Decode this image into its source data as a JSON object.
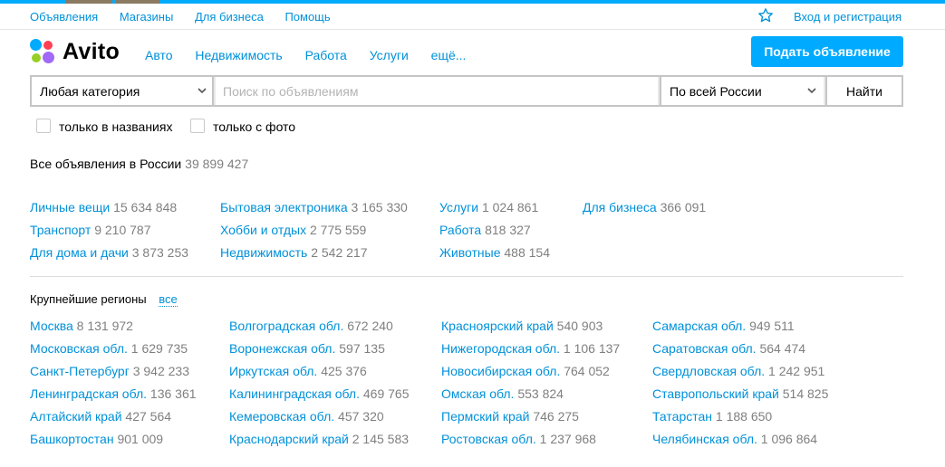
{
  "topbar": {
    "links": [
      "Объявления",
      "Магазины",
      "Для бизнеса",
      "Помощь"
    ],
    "login": "Вход и регистрация"
  },
  "header": {
    "logo": "Avito",
    "nav": [
      "Авто",
      "Недвижимость",
      "Работа",
      "Услуги",
      "ещё..."
    ],
    "post_button": "Подать объявление"
  },
  "search": {
    "category": "Любая категория",
    "placeholder": "Поиск по объявлениям",
    "value": "",
    "region": "По всей России",
    "button": "Найти"
  },
  "options": {
    "titles_only": "только в названиях",
    "with_photo": "только с фото",
    "titles_only_checked": false,
    "with_photo_checked": false
  },
  "total": {
    "label": "Все объявления в России",
    "count": "39 899 427"
  },
  "categories": [
    {
      "name": "Личные вещи",
      "count": "15 634 848"
    },
    {
      "name": "Транспорт",
      "count": "9 210 787"
    },
    {
      "name": "Для дома и дачи",
      "count": "3 873 253"
    },
    {
      "name": "Бытовая электроника",
      "count": "3 165 330"
    },
    {
      "name": "Хобби и отдых",
      "count": "2 775 559"
    },
    {
      "name": "Недвижимость",
      "count": "2 542 217"
    },
    {
      "name": "Услуги",
      "count": "1 024 861"
    },
    {
      "name": "Работа",
      "count": "818 327"
    },
    {
      "name": "Животные",
      "count": "488 154"
    },
    {
      "name": "Для бизнеса",
      "count": "366 091"
    }
  ],
  "regions_section": {
    "title": "Крупнейшие регионы",
    "all_link": "все"
  },
  "regions": [
    {
      "name": "Москва",
      "count": "8 131 972"
    },
    {
      "name": "Московская обл.",
      "count": "1 629 735"
    },
    {
      "name": "Санкт-Петербург",
      "count": "3 942 233"
    },
    {
      "name": "Ленинградская обл.",
      "count": "136 361"
    },
    {
      "name": "Алтайский край",
      "count": "427 564"
    },
    {
      "name": "Башкортостан",
      "count": "901 009"
    },
    {
      "name": "Волгоградская обл.",
      "count": "672 240"
    },
    {
      "name": "Воронежская обл.",
      "count": "597 135"
    },
    {
      "name": "Иркутская обл.",
      "count": "425 376"
    },
    {
      "name": "Калининградская обл.",
      "count": "469 765"
    },
    {
      "name": "Кемеровская обл.",
      "count": "457 320"
    },
    {
      "name": "Краснодарский край",
      "count": "2 145 583"
    },
    {
      "name": "Красноярский край",
      "count": "540 903"
    },
    {
      "name": "Нижегородская обл.",
      "count": "1 106 137"
    },
    {
      "name": "Новосибирская обл.",
      "count": "764 052"
    },
    {
      "name": "Омская обл.",
      "count": "553 824"
    },
    {
      "name": "Пермский край",
      "count": "746 275"
    },
    {
      "name": "Ростовская обл.",
      "count": "1 237 968"
    },
    {
      "name": "Самарская обл.",
      "count": "949 511"
    },
    {
      "name": "Саратовская обл.",
      "count": "564 474"
    },
    {
      "name": "Свердловская обл.",
      "count": "1 242 951"
    },
    {
      "name": "Ставропольский край",
      "count": "514 825"
    },
    {
      "name": "Татарстан",
      "count": "1 188 650"
    },
    {
      "name": "Челябинская обл.",
      "count": "1 096 864"
    }
  ],
  "colors": {
    "link": "#0091d9",
    "accent": "#00aaff",
    "count": "#7f7f7f",
    "logo_dots": [
      "#00aaff",
      "#ff4053",
      "#97cf26",
      "#a169f7"
    ]
  }
}
